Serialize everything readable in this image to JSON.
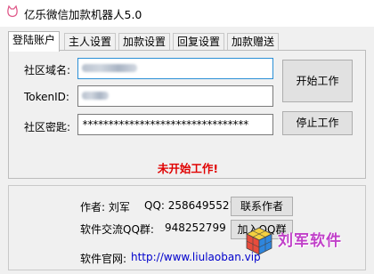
{
  "window": {
    "title": "亿乐微信加款机器人5.0",
    "icon": "app-cat-icon"
  },
  "tabs": [
    {
      "label": "登陆账户",
      "active": true
    },
    {
      "label": "主人设置",
      "active": false
    },
    {
      "label": "加款设置",
      "active": false
    },
    {
      "label": "回复设置",
      "active": false
    },
    {
      "label": "加款赠送",
      "active": false
    }
  ],
  "login": {
    "domain_label": "社区域名:",
    "token_label": "TokenID:",
    "secret_label": "社区密匙:",
    "secret_value": "********************************",
    "start_button": "开始工作",
    "stop_button": "停止工作",
    "status": "未开始工作!"
  },
  "info": {
    "author_label": "作者: 刘军",
    "qq_label": "QQ: 2586495521",
    "contact_button": "联系作者",
    "group_label": "软件交流QQ群:",
    "group_number": "948252799",
    "join_group_button": "加入QQ群",
    "site_label": "软件官网:",
    "site_url": "http://www.liulaoban.vip"
  },
  "watermark": {
    "text": "刘军软件",
    "icon": "rubiks-cube-icon"
  },
  "colors": {
    "status": "#e00000",
    "link": "#0000cc",
    "focus_border": "#2b8fd6",
    "watermark": "#c040c8"
  }
}
